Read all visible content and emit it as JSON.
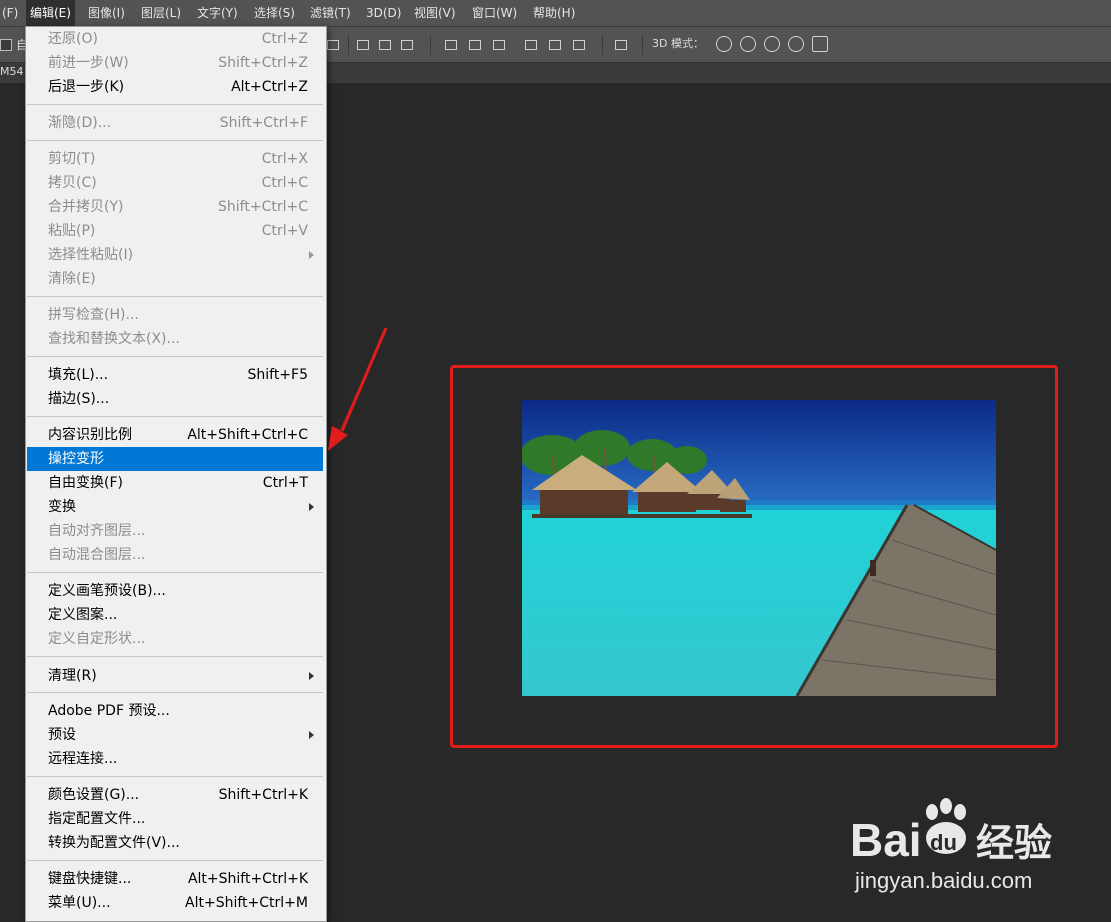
{
  "menubar": {
    "items": [
      "(F)",
      "编辑(E)",
      "图像(I)",
      "图层(L)",
      "文字(Y)",
      "选择(S)",
      "滤镜(T)",
      "3D(D)",
      "视图(V)",
      "窗口(W)",
      "帮助(H)"
    ]
  },
  "optionsbar": {
    "auto_label": "自",
    "mode_3d_label": "3D 模式："
  },
  "tabstrip": {
    "tab_label": "M54"
  },
  "edit_menu": {
    "items": [
      {
        "label": "还原(O)",
        "shortcut": "Ctrl+Z",
        "disabled": true
      },
      {
        "label": "前进一步(W)",
        "shortcut": "Shift+Ctrl+Z",
        "disabled": true
      },
      {
        "label": "后退一步(K)",
        "shortcut": "Alt+Ctrl+Z",
        "disabled": false
      },
      {
        "label": "渐隐(D)...",
        "shortcut": "Shift+Ctrl+F",
        "disabled": true
      },
      {
        "label": "剪切(T)",
        "shortcut": "Ctrl+X",
        "disabled": true
      },
      {
        "label": "拷贝(C)",
        "shortcut": "Ctrl+C",
        "disabled": true
      },
      {
        "label": "合并拷贝(Y)",
        "shortcut": "Shift+Ctrl+C",
        "disabled": true
      },
      {
        "label": "粘贴(P)",
        "shortcut": "Ctrl+V",
        "disabled": true
      },
      {
        "label": "选择性粘贴(I)",
        "shortcut": "",
        "disabled": true
      },
      {
        "label": "清除(E)",
        "shortcut": "",
        "disabled": true
      },
      {
        "label": "拼写检查(H)...",
        "shortcut": "",
        "disabled": true
      },
      {
        "label": "查找和替换文本(X)...",
        "shortcut": "",
        "disabled": true
      },
      {
        "label": "填充(L)...",
        "shortcut": "Shift+F5",
        "disabled": false
      },
      {
        "label": "描边(S)...",
        "shortcut": "",
        "disabled": false
      },
      {
        "label": "内容识别比例",
        "shortcut": "Alt+Shift+Ctrl+C",
        "disabled": false
      },
      {
        "label": "操控变形",
        "shortcut": "",
        "disabled": false,
        "highlighted": true
      },
      {
        "label": "自由变换(F)",
        "shortcut": "Ctrl+T",
        "disabled": false
      },
      {
        "label": "变换",
        "shortcut": "",
        "disabled": false
      },
      {
        "label": "自动对齐图层...",
        "shortcut": "",
        "disabled": true
      },
      {
        "label": "自动混合图层...",
        "shortcut": "",
        "disabled": true
      },
      {
        "label": "定义画笔预设(B)...",
        "shortcut": "",
        "disabled": false
      },
      {
        "label": "定义图案...",
        "shortcut": "",
        "disabled": false
      },
      {
        "label": "定义自定形状...",
        "shortcut": "",
        "disabled": true
      },
      {
        "label": "清理(R)",
        "shortcut": "",
        "disabled": false
      },
      {
        "label": "Adobe PDF 预设...",
        "shortcut": "",
        "disabled": false
      },
      {
        "label": "预设",
        "shortcut": "",
        "disabled": false
      },
      {
        "label": "远程连接...",
        "shortcut": "",
        "disabled": false
      },
      {
        "label": "颜色设置(G)...",
        "shortcut": "Shift+Ctrl+K",
        "disabled": false
      },
      {
        "label": "指定配置文件...",
        "shortcut": "",
        "disabled": false
      },
      {
        "label": "转换为配置文件(V)...",
        "shortcut": "",
        "disabled": false
      },
      {
        "label": "键盘快捷键...",
        "shortcut": "Alt+Shift+Ctrl+K",
        "disabled": false
      },
      {
        "label": "菜单(U)...",
        "shortcut": "Alt+Shift+Ctrl+M",
        "disabled": false
      }
    ]
  },
  "colors": {
    "highlight": "#0078d7",
    "annotation": "#e21b1b",
    "canvas": "#282828"
  },
  "watermark": {
    "brand_a": "Bai",
    "brand_b": "du",
    "brand_c": "经验",
    "url": "jingyan.baidu.com"
  }
}
